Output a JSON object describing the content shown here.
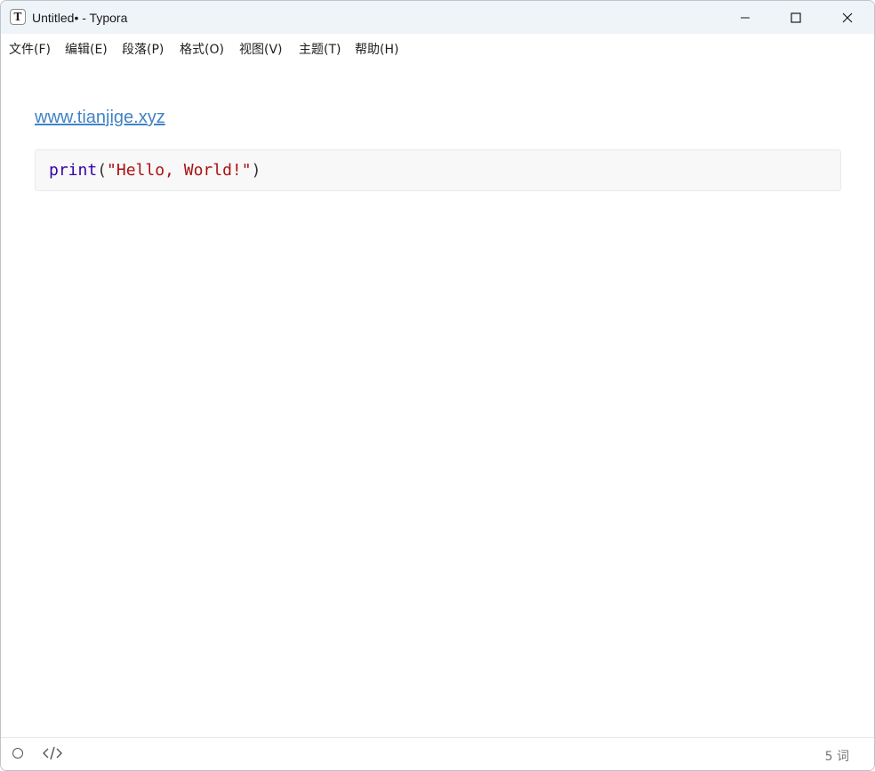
{
  "window": {
    "title": "Untitled• - Typora",
    "app_icon_letter": "T"
  },
  "window_controls": {
    "minimize_icon": "minimize-icon",
    "maximize_icon": "maximize-icon",
    "close_icon": "close-icon"
  },
  "menubar": {
    "items": [
      {
        "label": "文件(F)"
      },
      {
        "label": "编辑(E)"
      },
      {
        "label": "段落(P)"
      },
      {
        "label": "格式(O)"
      },
      {
        "label": "视图(V)"
      },
      {
        "label": "主题(T)"
      },
      {
        "label": "帮助(H)"
      }
    ]
  },
  "document": {
    "link_text": "www.tianjige.xyz",
    "code": {
      "func": "print",
      "open_paren": "(",
      "string": "\"Hello, World!\"",
      "close_paren": ")"
    }
  },
  "statusbar": {
    "word_count": "5 词",
    "outline_icon": "circle-icon",
    "source_mode_icon": "code-icon"
  },
  "colors": {
    "titlebar_bg": "#eff4f9",
    "link": "#4183c4",
    "code_bg": "#f8f8f8",
    "code_builtin": "#3300aa",
    "code_string": "#aa1111"
  }
}
